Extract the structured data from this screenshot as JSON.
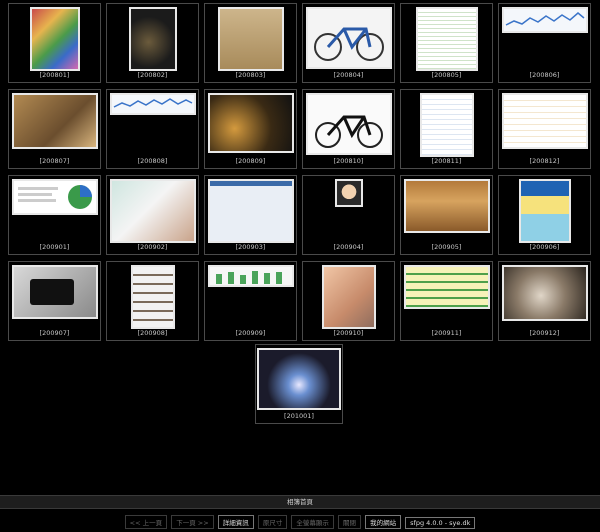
{
  "thumbnails": [
    {
      "caption": "[200801]",
      "depicts": "colorful candy bag"
    },
    {
      "caption": "[200802]",
      "depicts": "bicycle in dark room"
    },
    {
      "caption": "[200803]",
      "depicts": "cardboard box"
    },
    {
      "caption": "[200804]",
      "depicts": "blue road bicycle"
    },
    {
      "caption": "[200805]",
      "depicts": "spreadsheet screenshot"
    },
    {
      "caption": "[200806]",
      "depicts": "line chart screenshot"
    },
    {
      "caption": "[200807]",
      "depicts": "workshop desk"
    },
    {
      "caption": "[200808]",
      "depicts": "line chart screenshot"
    },
    {
      "caption": "[200809]",
      "depicts": "night street"
    },
    {
      "caption": "[200810]",
      "depicts": "black folding bicycle"
    },
    {
      "caption": "[200811]",
      "depicts": "web page screenshot"
    },
    {
      "caption": "[200812]",
      "depicts": "article page screenshot"
    },
    {
      "caption": "[200901]",
      "depicts": "report with pie chart"
    },
    {
      "caption": "[200902]",
      "depicts": "group portrait poster"
    },
    {
      "caption": "[200903]",
      "depicts": "desktop windows screenshot"
    },
    {
      "caption": "[200904]",
      "depicts": "cartoon avatar"
    },
    {
      "caption": "[200905]",
      "depicts": "menu board"
    },
    {
      "caption": "[200906]",
      "depicts": "book cover"
    },
    {
      "caption": "[200907]",
      "depicts": "media player device"
    },
    {
      "caption": "[200908]",
      "depicts": "bookshelf"
    },
    {
      "caption": "[200909]",
      "depicts": "bar chart screenshot"
    },
    {
      "caption": "[200910]",
      "depicts": "portrait photo"
    },
    {
      "caption": "[200911]",
      "depicts": "green data table"
    },
    {
      "caption": "[200912]",
      "depicts": "oysters on plate"
    },
    {
      "caption": "[201001]",
      "depicts": "fireworks photo"
    }
  ],
  "footer": {
    "home_link": "相簿首頁"
  },
  "buttons": {
    "prev": "<< 上一頁",
    "next": "下一頁 >>",
    "details": "詳細資訊",
    "original_size": "原尺寸",
    "show_all": "全螢幕顯示",
    "close": "關閉",
    "my_site": "我的網站",
    "version": "sfpg 4.0.0 - sye.dk"
  }
}
